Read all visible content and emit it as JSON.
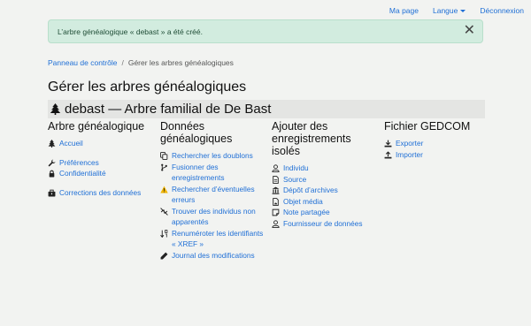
{
  "topnav": {
    "my_page": "Ma page",
    "language": "Langue",
    "logout": "Déconnexion"
  },
  "alert": {
    "message": "L’arbre généalogique « debast » a été créé.",
    "close_symbol": "✕"
  },
  "breadcrumb": {
    "home": "Panneau de contrôle",
    "separator": "/",
    "current": "Gérer les arbres généalogiques"
  },
  "page_title": "Gérer les arbres généalogiques",
  "tree": {
    "name": "debast — Arbre familial de De Bast"
  },
  "columns": {
    "tree": {
      "heading": "Arbre généalogique",
      "items": [
        "Accueil",
        "Préférences",
        "Confidentialité",
        "Corrections des données"
      ]
    },
    "data": {
      "heading": "Données généalogiques",
      "items": [
        "Rechercher les doublons",
        "Fusionner des enregistrements",
        "Rechercher d’éventuelles erreurs",
        "Trouver des individus non apparentés",
        "Renuméroter les identifiants « XREF »",
        "Journal des modifications"
      ]
    },
    "add": {
      "heading": "Ajouter des enregistrements isolés",
      "items": [
        "Individu",
        "Source",
        "Dépôt d’archives",
        "Objet média",
        "Note partagée",
        "Fournisseur de données"
      ]
    },
    "gedcom": {
      "heading": "Fichier GEDCOM",
      "items": [
        "Exporter",
        "Importer"
      ]
    }
  },
  "colors": {
    "link": "#1f6fd6",
    "alert_bg": "#d2ecdf",
    "warning": "#f0b400"
  }
}
